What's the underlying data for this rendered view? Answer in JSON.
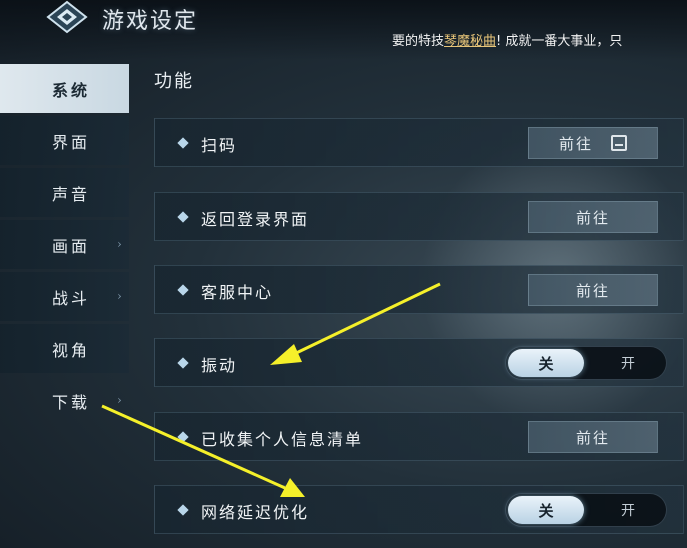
{
  "header": {
    "title": "游戏设定",
    "ticker_before": "要的特技",
    "ticker_highlight": "琴魔秘曲",
    "ticker_after": "! 成就一番大事业，只",
    "logo_icon": "diamond-emblem-icon"
  },
  "sidebar": {
    "items": [
      {
        "label": "系统",
        "active": true,
        "has_arrow": false
      },
      {
        "label": "界面",
        "active": false,
        "has_arrow": false
      },
      {
        "label": "声音",
        "active": false,
        "has_arrow": false
      },
      {
        "label": "画面",
        "active": false,
        "has_arrow": true
      },
      {
        "label": "战斗",
        "active": false,
        "has_arrow": true
      },
      {
        "label": "视角",
        "active": false,
        "has_arrow": false
      },
      {
        "label": "下载",
        "active": false,
        "has_arrow": true
      }
    ],
    "arrow_glyph": "›"
  },
  "section": {
    "title": "功能"
  },
  "rows": [
    {
      "label": "扫码",
      "control": "button",
      "button_label": "前往",
      "icon": "qr-scan-icon"
    },
    {
      "label": "返回登录界面",
      "control": "button",
      "button_label": "前往"
    },
    {
      "label": "客服中心",
      "control": "button",
      "button_label": "前往"
    },
    {
      "label": "振动",
      "control": "toggle",
      "off_label": "关",
      "on_label": "开",
      "state": "关"
    },
    {
      "label": "已收集个人信息清单",
      "control": "button",
      "button_label": "前往"
    },
    {
      "label": "网络延迟优化",
      "control": "toggle",
      "off_label": "关",
      "on_label": "开",
      "state": "关"
    }
  ],
  "colors": {
    "accent_highlight": "#e8c579",
    "annotation_arrow": "#f5f02a",
    "active_tab_bg": "#dfe8ee"
  }
}
